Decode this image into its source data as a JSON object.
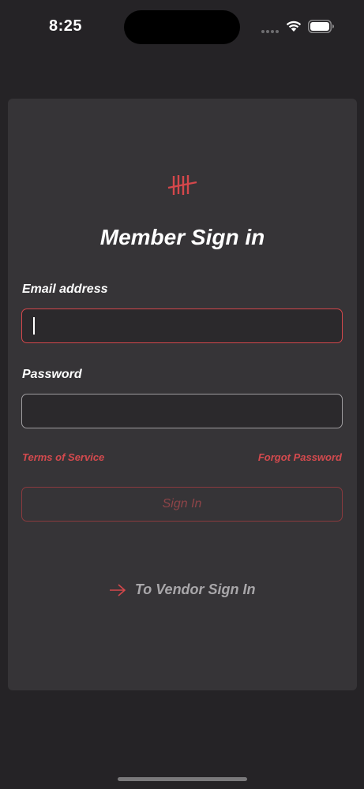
{
  "status_bar": {
    "time": "8:25",
    "icons": [
      "signal-dots-icon",
      "wifi-icon",
      "battery-icon"
    ]
  },
  "card": {
    "logo_icon": "tally-marks-logo-icon",
    "title": "Member Sign in",
    "email": {
      "label": "Email address",
      "value": "",
      "placeholder": ""
    },
    "password": {
      "label": "Password",
      "value": "",
      "placeholder": ""
    },
    "terms_link": "Terms of Service",
    "forgot_link": "Forgot Password",
    "signin_button": "Sign In",
    "vendor_link": "To Vendor Sign In"
  },
  "colors": {
    "background": "#252326",
    "card": "#363437",
    "accent": "#d4474b",
    "input_bg": "#2b292c",
    "muted_text": "#a9a7aa"
  }
}
